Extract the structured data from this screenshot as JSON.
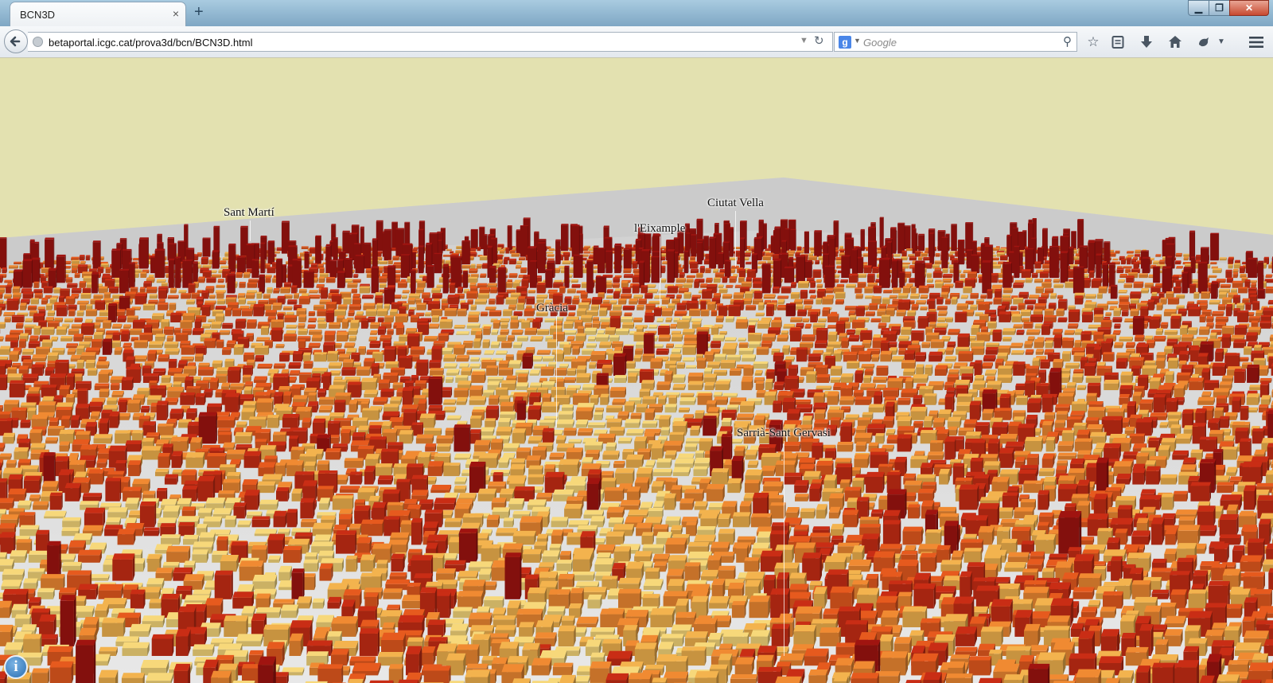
{
  "browser": {
    "tab_title": "BCN3D",
    "tab_close": "×",
    "new_tab": "+",
    "window_controls": {
      "minimize": "▁",
      "maximize": "❐",
      "close": "✕"
    },
    "url": "betaportal.icgc.cat/prova3d/bcn/BCN3D.html",
    "search_engine_glyph": "g",
    "search_placeholder": "Google",
    "toolbar_icons": [
      "star-bookmark-icon",
      "reading-list-icon",
      "download-icon",
      "home-icon",
      "addon-icon",
      "overflow-dropdown-icon",
      "hamburger-menu-icon"
    ]
  },
  "map": {
    "sky_color": "#e3e1b0",
    "ground_color": "#d7d7d7",
    "building_colors": [
      "#f7d87a",
      "#f3b34e",
      "#f08a32",
      "#e65a1e",
      "#c92d15",
      "#a01410"
    ],
    "districts": [
      {
        "name": "Sant Martí"
      },
      {
        "name": "Ciutat Vella"
      },
      {
        "name": "l'Eixample"
      },
      {
        "name": "Gràcia"
      },
      {
        "name": "Sarrià-Sant Gervasi"
      }
    ],
    "info_label": "i"
  }
}
